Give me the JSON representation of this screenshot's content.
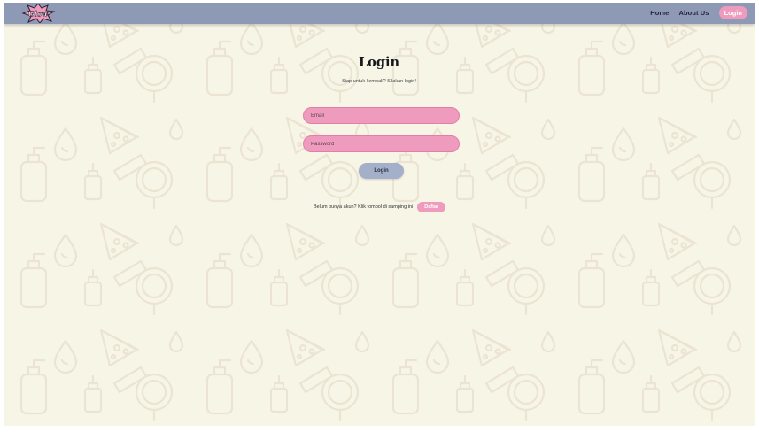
{
  "navbar": {
    "logo_text": "Glow",
    "links": [
      {
        "label": "Home"
      },
      {
        "label": "About Us"
      }
    ],
    "login_label": "Login"
  },
  "main": {
    "title": "Login",
    "subtitle": "Siap untuk kembali? Silakan login!",
    "email_placeholder": "Email",
    "password_placeholder": "Password",
    "login_button": "Login",
    "register_prompt": "Belum punya akun? Klik tombol di samping ini",
    "register_button": "Daftar"
  },
  "colors": {
    "navbar": "#8e99b6",
    "background": "#f7f5e6",
    "pink_accent": "#ef9bbd",
    "button_blue": "#a4afca",
    "pattern_stroke": "#ebe4d2"
  },
  "icons": [
    "lotion-bottle-icon",
    "pizza-slice-icon",
    "water-drop-icon",
    "perfume-bottle-icon",
    "dropper-bottle-icon",
    "tube-icon",
    "hand-mirror-icon"
  ]
}
